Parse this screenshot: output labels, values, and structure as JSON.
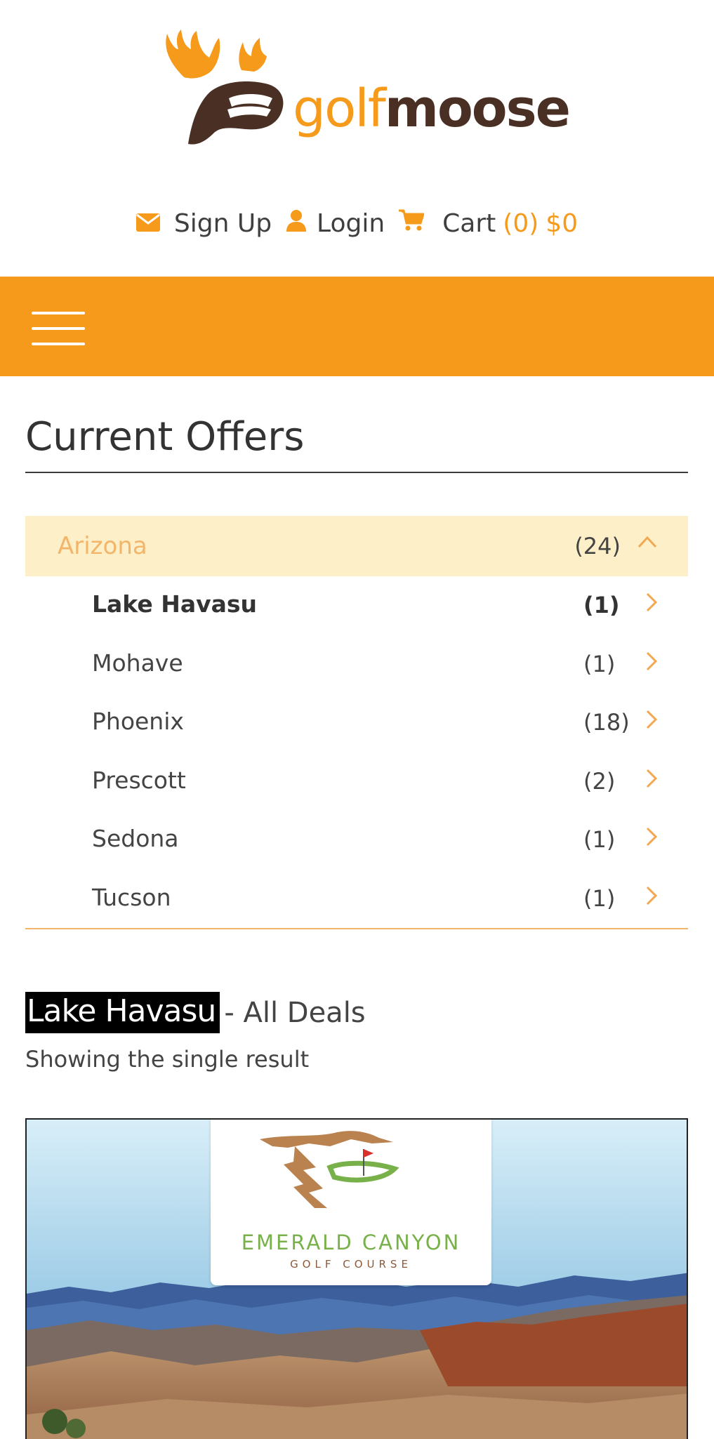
{
  "brand": {
    "part1": "golf",
    "part2": "moose",
    "accent_color": "#f59a1b",
    "dark_color": "#4a3024"
  },
  "account": {
    "signup_label": "Sign Up",
    "login_label": "Login",
    "cart_label": "Cart",
    "cart_count": "(0)",
    "cart_total": "$0",
    "signup_icon": "envelope-icon",
    "login_icon": "user-icon",
    "cart_icon": "cart-icon"
  },
  "nav": {
    "menu_icon": "hamburger-menu-icon",
    "bar_color": "#f59a1b"
  },
  "offers": {
    "title": "Current Offers",
    "state": {
      "name": "Arizona",
      "count": "(24)",
      "expanded": true
    },
    "cities": [
      {
        "name": "Lake Havasu",
        "count": "(1)",
        "active": true
      },
      {
        "name": "Mohave",
        "count": "(1)",
        "active": false
      },
      {
        "name": "Phoenix",
        "count": "(18)",
        "active": false
      },
      {
        "name": "Prescott",
        "count": "(2)",
        "active": false
      },
      {
        "name": "Sedona",
        "count": "(1)",
        "active": false
      },
      {
        "name": "Tucson",
        "count": "(1)",
        "active": false
      }
    ]
  },
  "deals": {
    "city": "Lake Havasu",
    "suffix": "- All Deals",
    "result_text": "Showing the single result"
  },
  "product": {
    "course_name": "EMERALD CANYON",
    "course_sub": "GOLF COURSE"
  }
}
